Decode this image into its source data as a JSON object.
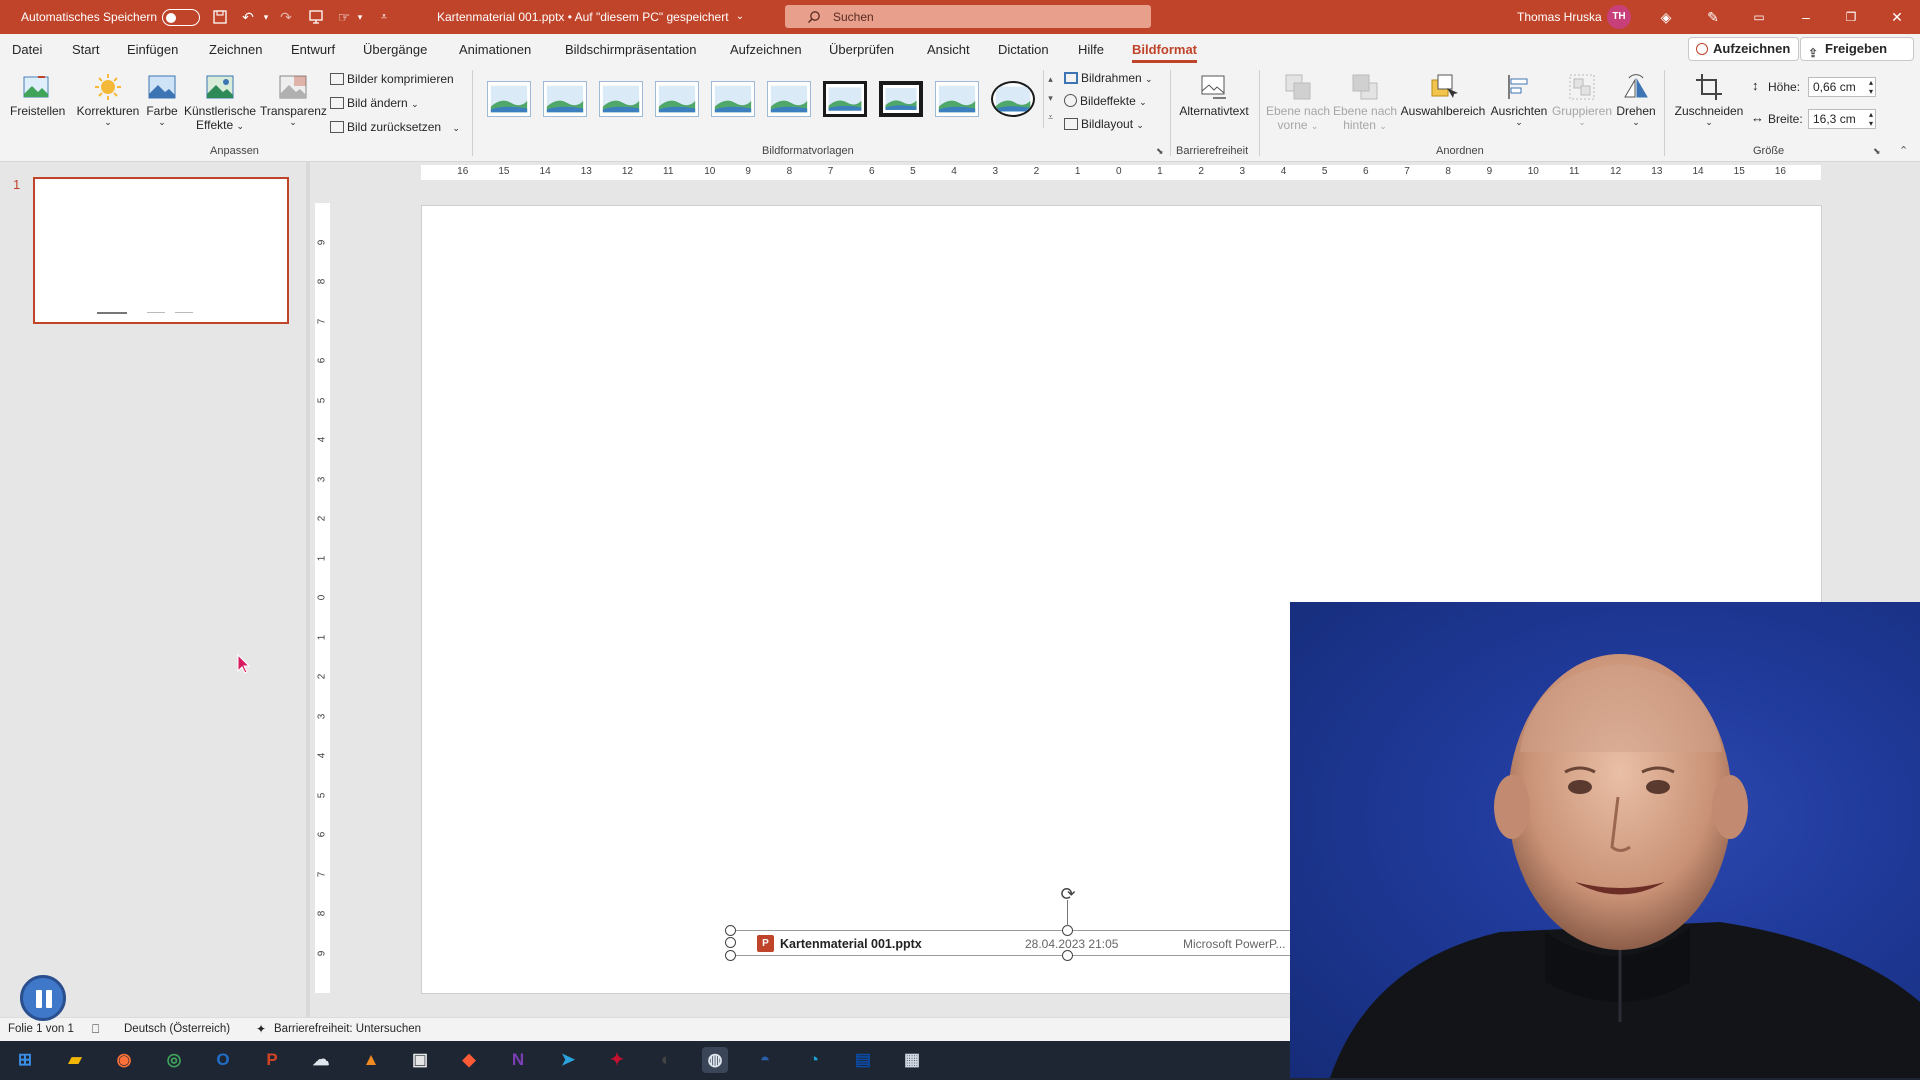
{
  "titlebar": {
    "autosave_label": "Automatisches Speichern",
    "doc_title": "Kartenmaterial 001.pptx • Auf \"diesem PC\" gespeichert",
    "search_placeholder": "Suchen",
    "user_name": "Thomas Hruska",
    "user_initials": "TH",
    "accent": "#c0442a"
  },
  "menubar": {
    "tabs": [
      "Datei",
      "Start",
      "Einfügen",
      "Zeichnen",
      "Entwurf",
      "Übergänge",
      "Animationen",
      "Bildschirmpräsentation",
      "Aufzeichnen",
      "Überprüfen",
      "Ansicht",
      "Dictation",
      "Hilfe",
      "Bildformat"
    ],
    "active_tab": "Bildformat",
    "record_button": "Aufzeichnen",
    "share_button": "Freigeben"
  },
  "ribbon": {
    "anpassen": {
      "freistellen": "Freistellen",
      "korrekturen": "Korrekturen",
      "farbe": "Farbe",
      "kuenstlerische_1": "Künstlerische",
      "kuenstlerische_2": "Effekte",
      "transparenz": "Transparenz",
      "komprimieren": "Bilder komprimieren",
      "aendern": "Bild ändern",
      "zuruecksetzen": "Bild zurücksetzen",
      "group_label": "Anpassen"
    },
    "bildformatvorlagen": {
      "bildrahmen": "Bildrahmen",
      "bildeffekte": "Bildeffekte",
      "bildlayout": "Bildlayout",
      "group_label": "Bildformatvorlagen"
    },
    "barrierefreiheit": {
      "alternativtext": "Alternativtext",
      "group_label": "Barrierefreiheit"
    },
    "anordnen": {
      "ebene_vorne_1": "Ebene nach",
      "ebene_vorne_2": "vorne",
      "ebene_hinten_1": "Ebene nach",
      "ebene_hinten_2": "hinten",
      "auswahlbereich": "Auswahlbereich",
      "ausrichten": "Ausrichten",
      "gruppieren": "Gruppieren",
      "drehen": "Drehen",
      "group_label": "Anordnen"
    },
    "groesse": {
      "zuschneiden": "Zuschneiden",
      "hoehe_label": "Höhe:",
      "hoehe_value": "0,66 cm",
      "breite_label": "Breite:",
      "breite_value": "16,3 cm",
      "group_label": "Größe"
    }
  },
  "slides_pane": {
    "slide_number": "1"
  },
  "rulers": {
    "horizontal": [
      "16",
      "15",
      "14",
      "13",
      "12",
      "11",
      "10",
      "9",
      "8",
      "7",
      "6",
      "5",
      "4",
      "3",
      "2",
      "1",
      "0",
      "1",
      "2",
      "3",
      "4",
      "5",
      "6",
      "7",
      "8",
      "9",
      "10",
      "11",
      "12",
      "13",
      "14",
      "15",
      "16"
    ],
    "vertical": [
      "9",
      "8",
      "7",
      "6",
      "5",
      "4",
      "3",
      "2",
      "1",
      "0",
      "1",
      "2",
      "3",
      "4",
      "5",
      "6",
      "7",
      "8",
      "9"
    ]
  },
  "slide": {
    "file_name": "Kartenmaterial 001.pptx",
    "file_date": "28.04.2023 21:05",
    "file_app": "Microsoft PowerP..."
  },
  "statusbar": {
    "slide_info": "Folie 1 von 1",
    "language": "Deutsch (Österreich)",
    "accessibility": "Barrierefreiheit: Untersuchen"
  },
  "taskbar": {
    "apps": [
      "windows-start",
      "file-explorer",
      "firefox",
      "chrome",
      "outlook",
      "powerpoint",
      "app-7",
      "vlc",
      "app-9",
      "app-10",
      "onenote",
      "telegram",
      "app-13",
      "obs",
      "app-15",
      "app-16",
      "edge",
      "app-18",
      "app-19"
    ]
  }
}
